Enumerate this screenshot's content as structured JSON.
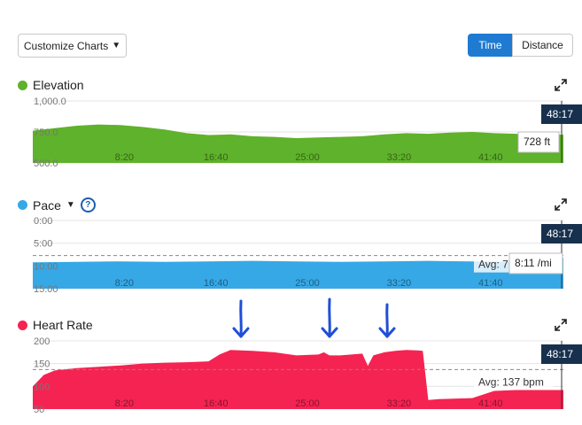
{
  "toolbar": {
    "customize_label": "Customize Charts",
    "time_label": "Time",
    "distance_label": "Distance",
    "selected_mode": "Time"
  },
  "colors": {
    "elevation": "#5fb22b",
    "pace": "#37a8e6",
    "heart_rate": "#f52352",
    "accent": "#1f7bd1",
    "cursor_badge": "#17304e",
    "annotation_arrows": "#1f4fd8"
  },
  "x_tick_labels": [
    "8:20",
    "16:40",
    "25:00",
    "33:20",
    "41:40"
  ],
  "cursor_time": "48:17",
  "elevation": {
    "title": "Elevation",
    "tooltip": "728 ft"
  },
  "pace": {
    "title": "Pace",
    "avg_label": "Avg: 7:44 /mi",
    "tooltip": "8:11 /mi"
  },
  "heart_rate": {
    "title": "Heart Rate",
    "avg_label": "Avg: 137 bpm"
  },
  "chart_data": [
    {
      "type": "area",
      "title": "Elevation",
      "ylabel": "",
      "xlabel": "",
      "x_tick_labels": [
        "8:20",
        "16:40",
        "25:00",
        "33:20",
        "41:40"
      ],
      "x_unit": "minutes",
      "ylim": [
        500,
        1000
      ],
      "y_ticks": [
        "500.0",
        "750.0",
        "1,000.0"
      ],
      "y_tick_values": [
        500,
        750,
        1000
      ],
      "grid": true,
      "series": [
        {
          "name": "Elevation",
          "x": [
            0,
            2,
            4,
            6,
            8,
            10,
            12,
            14,
            16,
            18,
            20,
            22,
            24,
            26,
            28,
            30,
            32,
            34,
            36,
            38,
            40,
            42,
            44,
            46,
            48.3
          ],
          "values": [
            760,
            780,
            800,
            810,
            805,
            790,
            770,
            740,
            725,
            730,
            715,
            710,
            700,
            705,
            710,
            715,
            730,
            740,
            735,
            745,
            750,
            740,
            735,
            730,
            728
          ]
        }
      ],
      "cursor": {
        "x": 48.3,
        "label": "48:17",
        "value_label": "728 ft"
      }
    },
    {
      "type": "area",
      "title": "Pace",
      "ylabel": "",
      "xlabel": "",
      "x_tick_labels": [
        "8:20",
        "16:40",
        "25:00",
        "33:20",
        "41:40"
      ],
      "x_unit": "minutes",
      "ylim": [
        0,
        15
      ],
      "y_ticks": [
        "0:00",
        "5:00",
        "10:00",
        "15:00"
      ],
      "y_tick_values": [
        0,
        5,
        10,
        15
      ],
      "inverted": true,
      "grid": true,
      "average": 7.73,
      "average_label": "Avg: 7:44 /mi",
      "series": [
        {
          "name": "Pace",
          "x": [
            0,
            4,
            8,
            12,
            16,
            20,
            24,
            28,
            32,
            36,
            40,
            44,
            48.3
          ],
          "values": [
            9.2,
            9.1,
            9.0,
            9.1,
            9.0,
            8.9,
            9.0,
            9.1,
            9.0,
            8.9,
            9.0,
            9.1,
            8.2
          ]
        }
      ],
      "cursor": {
        "x": 48.3,
        "label": "48:17",
        "value_label": "8:11 /mi"
      }
    },
    {
      "type": "area",
      "title": "Heart Rate",
      "ylabel": "",
      "xlabel": "",
      "x_tick_labels": [
        "8:20",
        "16:40",
        "25:00",
        "33:20",
        "41:40"
      ],
      "x_unit": "minutes",
      "ylim": [
        50,
        200
      ],
      "y_ticks": [
        "50",
        "100",
        "150",
        "200"
      ],
      "y_tick_values": [
        50,
        100,
        150,
        200
      ],
      "grid": true,
      "average": 137,
      "average_label": "Avg: 137 bpm",
      "series": [
        {
          "name": "Heart Rate",
          "x": [
            0,
            1,
            2,
            4,
            6,
            8,
            10,
            12,
            14,
            16,
            17,
            18,
            20,
            22,
            24,
            26,
            26.5,
            27,
            28,
            29,
            30,
            30.5,
            31,
            32,
            33,
            34,
            35,
            35.5,
            36,
            37,
            40,
            42,
            44,
            45,
            48.3
          ],
          "values": [
            100,
            125,
            135,
            140,
            143,
            146,
            150,
            152,
            153,
            155,
            170,
            180,
            178,
            175,
            168,
            170,
            175,
            168,
            168,
            170,
            172,
            145,
            168,
            175,
            178,
            180,
            179,
            178,
            70,
            72,
            74,
            90,
            92,
            92,
            92
          ]
        }
      ],
      "cursor": {
        "x": 48.3,
        "label": "48:17"
      },
      "annotations": [
        "arrow",
        "arrow",
        "arrow"
      ]
    }
  ]
}
